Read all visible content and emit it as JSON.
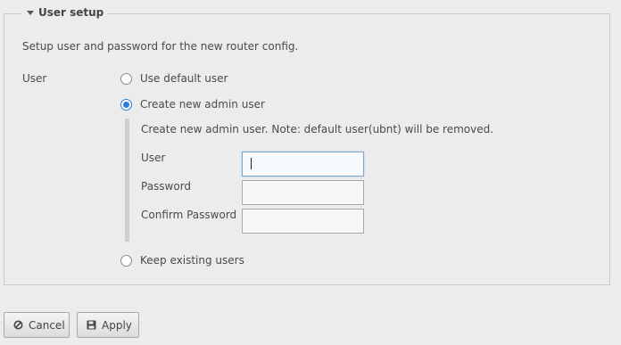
{
  "section": {
    "title": "User setup",
    "description": "Setup user and password for the new router config.",
    "user_label": "User"
  },
  "options": {
    "default": "Use default user",
    "create": "Create new admin user",
    "keep": "Keep existing users",
    "selected": "create"
  },
  "admin": {
    "note": "Create new admin user. Note: default user(ubnt) will be removed.",
    "user_label": "User",
    "user_value": "",
    "password_label": "Password",
    "password_value": "",
    "confirm_label": "Confirm Password",
    "confirm_value": ""
  },
  "buttons": {
    "cancel": "Cancel",
    "apply": "Apply"
  },
  "icons": {
    "legend": "caret-down-icon",
    "cancel": "ban-icon",
    "apply": "floppy-disk-icon"
  },
  "colors": {
    "accent": "#2d7ed8",
    "background": "#ececec"
  }
}
